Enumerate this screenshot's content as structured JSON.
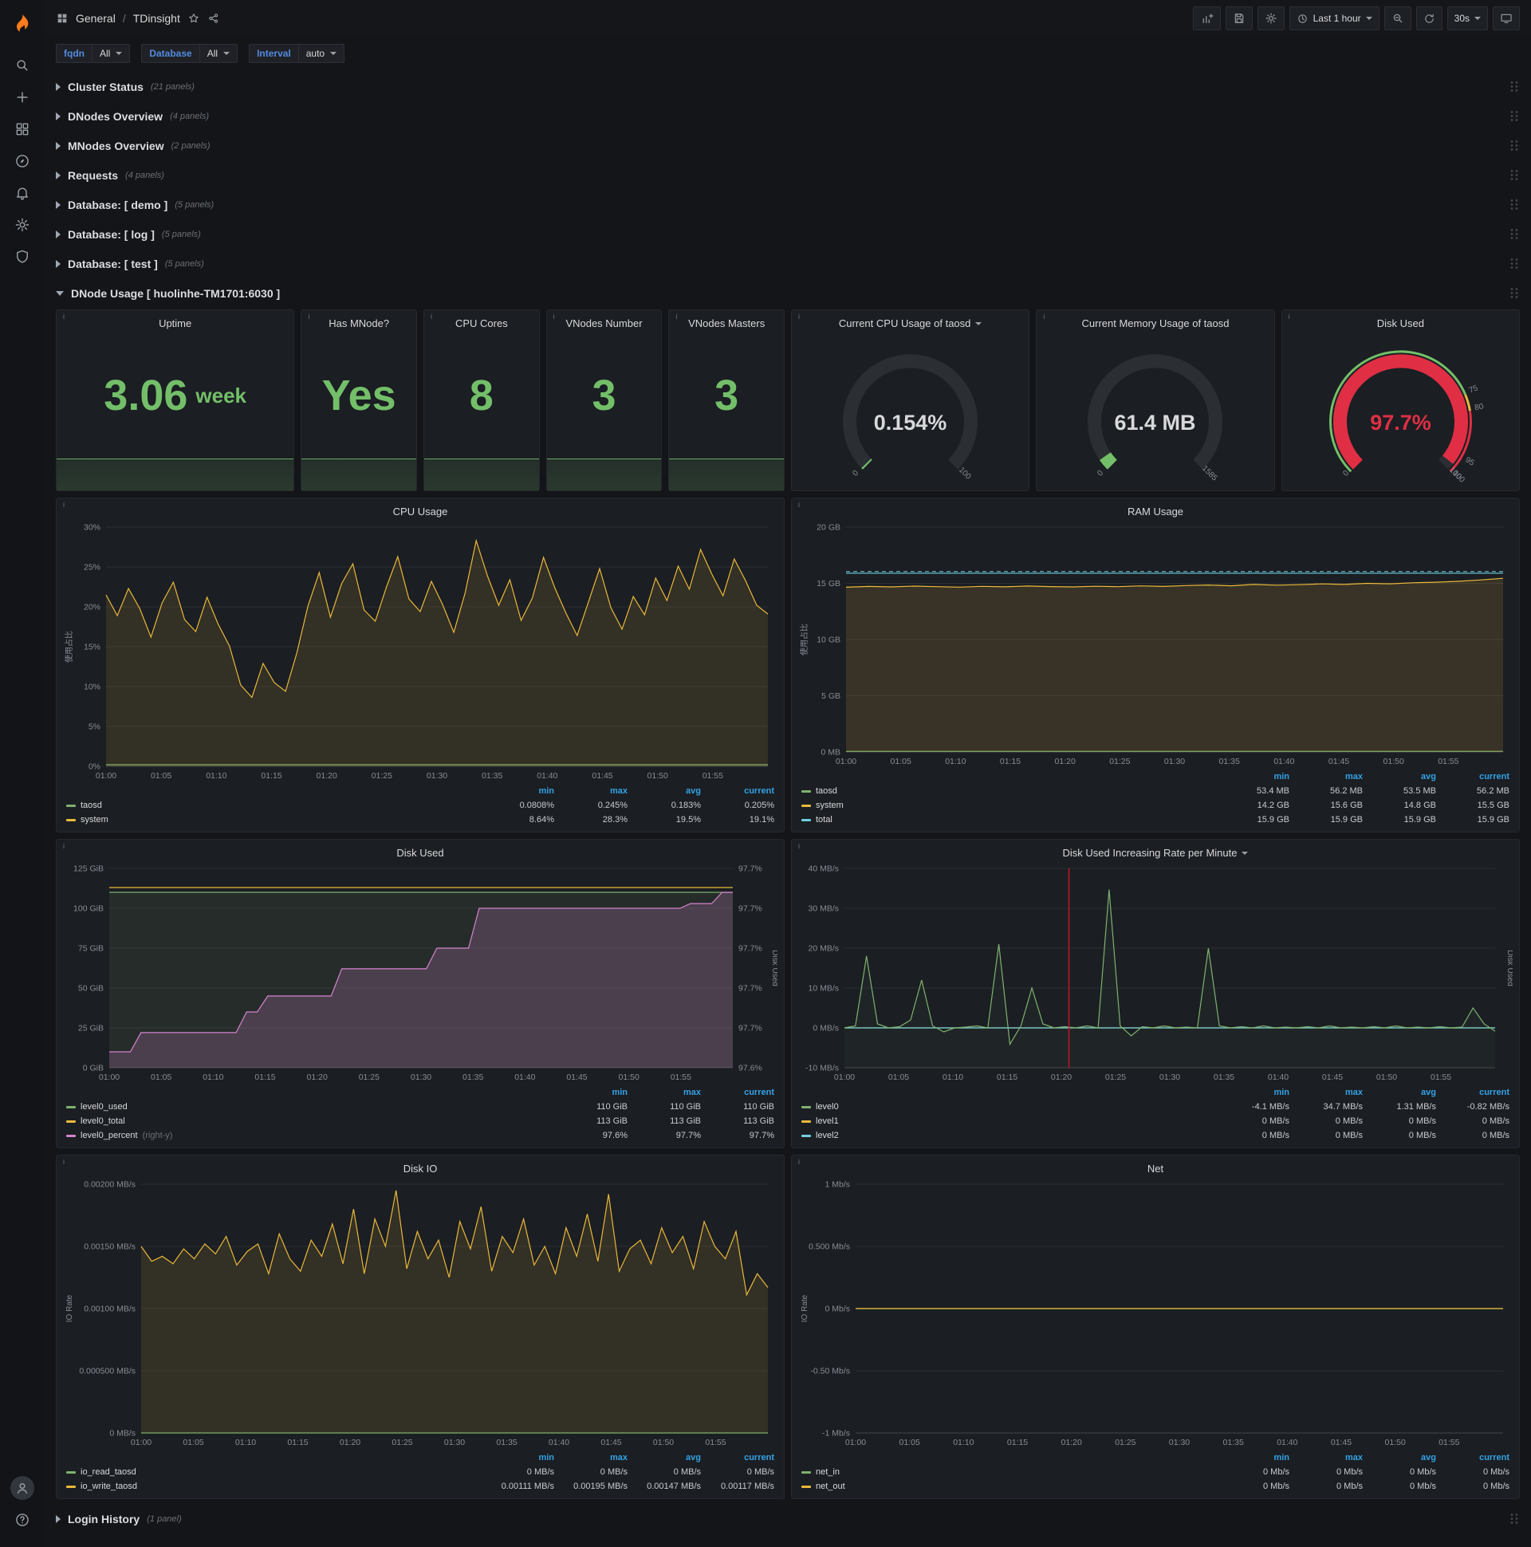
{
  "nav": {
    "breadcrumb_section": "General",
    "breadcrumb_sep": "/",
    "dashboard_title": "TDinsight",
    "time_range": "Last 1 hour",
    "refresh_interval": "30s"
  },
  "variables": [
    {
      "label": "fqdn",
      "value": "All"
    },
    {
      "label": "Database",
      "value": "All"
    },
    {
      "label": "Interval",
      "value": "auto"
    }
  ],
  "rows_top": [
    {
      "title": "Cluster Status",
      "count": "(21 panels)"
    },
    {
      "title": "DNodes Overview",
      "count": "(4 panels)"
    },
    {
      "title": "MNodes Overview",
      "count": "(2 panels)"
    },
    {
      "title": "Requests",
      "count": "(4 panels)"
    },
    {
      "title": "Database: [ demo ]",
      "count": "(5 panels)"
    },
    {
      "title": "Database: [ log ]",
      "count": "(5 panels)"
    },
    {
      "title": "Database: [ test ]",
      "count": "(5 panels)"
    }
  ],
  "dnode_row": {
    "title": "DNode Usage [ huolinhe-TM1701:6030 ]"
  },
  "rows_bottom": [
    {
      "title": "Login History",
      "count": "(1 panel)"
    }
  ],
  "stats": [
    {
      "title": "Uptime",
      "value": "3.06",
      "unit": "week"
    },
    {
      "title": "Has MNode?",
      "value": "Yes",
      "unit": ""
    },
    {
      "title": "CPU Cores",
      "value": "8",
      "unit": ""
    },
    {
      "title": "VNodes Number",
      "value": "3",
      "unit": ""
    },
    {
      "title": "VNodes Masters",
      "value": "3",
      "unit": ""
    }
  ],
  "gauges": [
    {
      "title": "Current CPU Usage of taosd",
      "value": "0.154%",
      "min_label": "0",
      "max_label": "100",
      "fraction": 0.00154,
      "color": "#73BF69",
      "value_color": "#d8d9da"
    },
    {
      "title": "Current Memory Usage of taosd",
      "value": "61.4 MB",
      "min_label": "0",
      "max_label": "1585",
      "fraction": 0.0387,
      "color": "#73BF69",
      "value_color": "#d8d9da"
    },
    {
      "title": "Disk Used",
      "value": "97.7%",
      "min_label": "0",
      "max_label": "100",
      "fraction": 0.977,
      "color": "#E02F44",
      "value_color": "#E02F44",
      "thresholds": [
        {
          "from": 0,
          "to": 0.75,
          "color": "#73BF69"
        },
        {
          "from": 0.75,
          "to": 0.8,
          "color": "#EAB839"
        },
        {
          "from": 0.8,
          "to": 1,
          "color": "#E02F44"
        }
      ],
      "threshold_labels": [
        {
          "f": 0.75,
          "t": "75"
        },
        {
          "f": 0.8,
          "t": "80"
        },
        {
          "f": 0.95,
          "t": "95"
        },
        {
          "f": 1,
          "t": "100"
        }
      ]
    }
  ],
  "charts": {
    "cpu_usage": {
      "title": "CPU Usage",
      "ylabel": "使用占比",
      "ml": 38,
      "ymin": 0,
      "ymax": 30,
      "y_ticks": [
        "30%",
        "25%",
        "20%",
        "15%",
        "10%",
        "5%",
        "0%"
      ],
      "x_ticks": [
        "01:00",
        "01:05",
        "01:10",
        "01:15",
        "01:20",
        "01:25",
        "01:30",
        "01:35",
        "01:40",
        "01:45",
        "01:50",
        "01:55"
      ],
      "series": [
        {
          "name": "taosd",
          "color": "#7EB26D",
          "fill": 0.06,
          "values": [
            0.2,
            0.2,
            0.2,
            0.2,
            0.2,
            0.2,
            0.2,
            0.2,
            0.2,
            0.2,
            0.2,
            0.2
          ]
        },
        {
          "name": "system",
          "color": "#EAB839",
          "fill": 0.12,
          "values": [
            21.5,
            18.9,
            22.3,
            19.8,
            16.2,
            20.5,
            23.1,
            18.4,
            16.9,
            21.2,
            17.8,
            15.1,
            10.2,
            8.64,
            12.9,
            10.5,
            9.4,
            14.2,
            20.1,
            24.3,
            18.7,
            22.9,
            25.4,
            19.6,
            18.2,
            22.5,
            26.3,
            21.0,
            19.4,
            23.2,
            20.3,
            16.8,
            21.7,
            28.3,
            23.9,
            20.2,
            23.4,
            18.3,
            21.1,
            26.2,
            22.4,
            19.2,
            16.4,
            20.6,
            24.8,
            19.9,
            17.2,
            21.3,
            19.0,
            23.6,
            20.8,
            25.1,
            22.2,
            27.2,
            24.1,
            21.4,
            26.0,
            23.3,
            20.2,
            19.1
          ]
        }
      ],
      "legend": {
        "columns": [
          "min",
          "max",
          "avg",
          "current"
        ],
        "rows": [
          {
            "name": "taosd",
            "color": "#7EB26D",
            "values": [
              "0.0808%",
              "0.245%",
              "0.183%",
              "0.205%"
            ]
          },
          {
            "name": "system",
            "color": "#EAB839",
            "values": [
              "8.64%",
              "28.3%",
              "19.5%",
              "19.1%"
            ]
          }
        ]
      }
    },
    "ram_usage": {
      "title": "RAM Usage",
      "ylabel": "使用占比",
      "ml": 44,
      "ymin": 0,
      "ymax": 20,
      "y_ticks": [
        "20 GB",
        "15 GB",
        "10 GB",
        "5 GB",
        "0 MB"
      ],
      "x_ticks": [
        "01:00",
        "01:05",
        "01:10",
        "01:15",
        "01:20",
        "01:25",
        "01:30",
        "01:35",
        "01:40",
        "01:45",
        "01:50",
        "01:55"
      ],
      "hline": {
        "y": 16.05,
        "color": "#6ED0E0"
      },
      "series": [
        {
          "name": "taosd",
          "color": "#7EB26D",
          "fill": 0.06,
          "values": [
            0.055,
            0.055,
            0.055,
            0.055,
            0.055,
            0.055,
            0.055,
            0.055,
            0.055,
            0.055,
            0.055,
            0.055
          ]
        },
        {
          "name": "system",
          "color": "#EAB839",
          "fill": 0.14,
          "values": [
            14.65,
            14.72,
            14.68,
            14.75,
            14.7,
            14.66,
            14.73,
            14.69,
            14.76,
            14.71,
            14.68,
            14.74,
            14.7,
            14.77,
            14.72,
            14.8,
            14.85,
            14.78,
            14.9,
            14.84,
            14.88,
            14.95,
            14.9,
            15.0,
            14.96,
            15.05,
            15.1,
            15.18,
            15.3,
            15.45
          ]
        },
        {
          "name": "total",
          "color": "#6ED0E0",
          "fill": 0,
          "values": [
            15.9,
            15.9,
            15.9,
            15.9,
            15.9,
            15.9,
            15.9,
            15.9,
            15.9,
            15.9,
            15.9,
            15.9
          ]
        }
      ],
      "legend": {
        "columns": [
          "min",
          "max",
          "avg",
          "current"
        ],
        "rows": [
          {
            "name": "taosd",
            "color": "#7EB26D",
            "values": [
              "53.4 MB",
              "56.2 MB",
              "53.5 MB",
              "56.2 MB"
            ]
          },
          {
            "name": "system",
            "color": "#EAB839",
            "values": [
              "14.2 GB",
              "15.6 GB",
              "14.8 GB",
              "15.5 GB"
            ]
          },
          {
            "name": "total",
            "color": "#6ED0E0",
            "values": [
              "15.9 GB",
              "15.9 GB",
              "15.9 GB",
              "15.9 GB"
            ]
          }
        ]
      }
    },
    "disk_used": {
      "title": "Disk Used",
      "ml": 52,
      "ymin": 0,
      "ymax": 125,
      "y_ticks": [
        "125 GiB",
        "100 GiB",
        "75 GiB",
        "50 GiB",
        "25 GiB",
        "0 GiB"
      ],
      "y2_ticks": [
        "97.7%",
        "97.7%",
        "97.7%",
        "97.7%",
        "97.7%",
        "97.6%"
      ],
      "y2min": 97.6,
      "y2max": 97.71,
      "y2label": "Disk Used",
      "x_ticks": [
        "01:00",
        "01:05",
        "01:10",
        "01:15",
        "01:20",
        "01:25",
        "01:30",
        "01:35",
        "01:40",
        "01:45",
        "01:50",
        "01:55"
      ],
      "series": [
        {
          "name": "level0_used",
          "color": "#7EB26D",
          "fill": 0.1,
          "values": [
            110,
            110,
            110,
            110,
            110,
            110,
            110,
            110,
            110,
            110,
            110,
            110
          ]
        },
        {
          "name": "level0_total",
          "color": "#EAB839",
          "fill": 0,
          "values": [
            113,
            113,
            113,
            113,
            113,
            113,
            113,
            113,
            113,
            113,
            113,
            113
          ]
        },
        {
          "name": "level0_percent",
          "color": "#D683CE",
          "fill": 0.22,
          "axis": 2,
          "values": [
            97.6088,
            97.6088,
            97.6088,
            97.6194,
            97.6194,
            97.6194,
            97.6194,
            97.6194,
            97.6194,
            97.6194,
            97.6194,
            97.6194,
            97.6194,
            97.6308,
            97.6308,
            97.6396,
            97.6396,
            97.6396,
            97.6396,
            97.6396,
            97.6396,
            97.6396,
            97.6546,
            97.6546,
            97.6546,
            97.6546,
            97.6546,
            97.6546,
            97.6546,
            97.6546,
            97.6546,
            97.666,
            97.666,
            97.666,
            97.666,
            97.688,
            97.688,
            97.688,
            97.688,
            97.688,
            97.688,
            97.688,
            97.688,
            97.688,
            97.688,
            97.688,
            97.688,
            97.688,
            97.688,
            97.688,
            97.688,
            97.688,
            97.688,
            97.688,
            97.688,
            97.6906,
            97.6906,
            97.6906,
            97.6968,
            97.6968
          ]
        }
      ],
      "legend": {
        "columns": [
          "min",
          "max",
          "current"
        ],
        "rows": [
          {
            "name": "level0_used",
            "color": "#7EB26D",
            "values": [
              "110 GiB",
              "110 GiB",
              "110 GiB"
            ]
          },
          {
            "name": "level0_total",
            "color": "#EAB839",
            "values": [
              "113 GiB",
              "113 GiB",
              "113 GiB"
            ]
          },
          {
            "name": "level0_percent",
            "suffix": "(right-y)",
            "color": "#D683CE",
            "values": [
              "97.6%",
              "97.7%",
              "97.7%"
            ]
          }
        ]
      }
    },
    "disk_rate": {
      "title": "Disk Used Increasing Rate per Minute",
      "has_caret": true,
      "ml": 52,
      "ymin": -10,
      "ymax": 40,
      "y_ticks": [
        "40 MB/s",
        "30 MB/s",
        "20 MB/s",
        "10 MB/s",
        "0 MB/s",
        "-10 MB/s"
      ],
      "y2label": "Disk Used",
      "vline": 0.345,
      "x_ticks": [
        "01:00",
        "01:05",
        "01:10",
        "01:15",
        "01:20",
        "01:25",
        "01:30",
        "01:35",
        "01:40",
        "01:45",
        "01:50",
        "01:55"
      ],
      "series": [
        {
          "name": "level1",
          "color": "#EAB839",
          "fill": 0,
          "values": [
            0,
            0,
            0,
            0,
            0,
            0,
            0,
            0,
            0,
            0,
            0,
            0
          ]
        },
        {
          "name": "level2",
          "color": "#6ED0E0",
          "fill": 0,
          "values": [
            0,
            0,
            0,
            0,
            0,
            0,
            0,
            0,
            0,
            0,
            0,
            0
          ]
        },
        {
          "name": "level0",
          "color": "#7EB26D",
          "fill": 0.05,
          "values": [
            0,
            0.5,
            18,
            1,
            0,
            0.3,
            2,
            12,
            0.5,
            -1,
            0,
            0.2,
            0.5,
            0,
            21,
            -4.1,
            0.5,
            10,
            1,
            0,
            0.3,
            0,
            0.5,
            0,
            34.7,
            0.5,
            -2,
            0.3,
            0,
            0.5,
            0,
            0.2,
            0,
            20,
            0.5,
            0,
            0.3,
            0,
            0.5,
            0,
            0.2,
            0,
            0.3,
            0,
            0.5,
            0,
            0.2,
            0,
            0.3,
            0,
            0.5,
            0,
            0.2,
            0,
            0.3,
            0,
            0.2,
            5,
            1,
            -0.82
          ]
        }
      ],
      "legend": {
        "columns": [
          "min",
          "max",
          "avg",
          "current"
        ],
        "rows": [
          {
            "name": "level0",
            "color": "#7EB26D",
            "values": [
              "-4.1 MB/s",
              "34.7 MB/s",
              "1.31 MB/s",
              "-0.82 MB/s"
            ]
          },
          {
            "name": "level1",
            "color": "#EAB839",
            "values": [
              "0 MB/s",
              "0 MB/s",
              "0 MB/s",
              "0 MB/s"
            ]
          },
          {
            "name": "level2",
            "color": "#6ED0E0",
            "values": [
              "0 MB/s",
              "0 MB/s",
              "0 MB/s",
              "0 MB/s"
            ]
          }
        ]
      }
    },
    "disk_io": {
      "title": "Disk IO",
      "ylabel": "IO Rate",
      "ml": 82,
      "ymin": 0,
      "ymax": 0.002,
      "y_ticks": [
        "0.00200 MB/s",
        "0.00150 MB/s",
        "0.00100 MB/s",
        "0.000500 MB/s",
        "0 MB/s"
      ],
      "x_ticks": [
        "01:00",
        "01:05",
        "01:10",
        "01:15",
        "01:20",
        "01:25",
        "01:30",
        "01:35",
        "01:40",
        "01:45",
        "01:50",
        "01:55"
      ],
      "series": [
        {
          "name": "io_read_taosd",
          "color": "#7EB26D",
          "fill": 0,
          "values": [
            0,
            0,
            0,
            0,
            0,
            0,
            0,
            0,
            0,
            0,
            0,
            0
          ]
        },
        {
          "name": "io_write_taosd",
          "color": "#EAB839",
          "fill": 0.12,
          "values": [
            0.0015,
            0.00138,
            0.00142,
            0.00136,
            0.00148,
            0.0014,
            0.00152,
            0.00144,
            0.00158,
            0.00135,
            0.00146,
            0.00152,
            0.00128,
            0.0016,
            0.0014,
            0.0013,
            0.00155,
            0.00142,
            0.00168,
            0.00136,
            0.0018,
            0.00128,
            0.00172,
            0.0015,
            0.00195,
            0.00132,
            0.00162,
            0.0014,
            0.00155,
            0.00125,
            0.0017,
            0.00148,
            0.00182,
            0.0013,
            0.00158,
            0.00145,
            0.00172,
            0.00135,
            0.0015,
            0.00128,
            0.00165,
            0.00142,
            0.00176,
            0.00138,
            0.00192,
            0.0013,
            0.00148,
            0.00155,
            0.00136,
            0.00165,
            0.00145,
            0.00158,
            0.00132,
            0.0017,
            0.0015,
            0.0014,
            0.00162,
            0.00111,
            0.00128,
            0.00117
          ]
        }
      ],
      "legend": {
        "columns": [
          "min",
          "max",
          "avg",
          "current"
        ],
        "rows": [
          {
            "name": "io_read_taosd",
            "color": "#7EB26D",
            "values": [
              "0 MB/s",
              "0 MB/s",
              "0 MB/s",
              "0 MB/s"
            ]
          },
          {
            "name": "io_write_taosd",
            "color": "#EAB839",
            "values": [
              "0.00111 MB/s",
              "0.00195 MB/s",
              "0.00147 MB/s",
              "0.00117 MB/s"
            ]
          }
        ]
      }
    },
    "net": {
      "title": "Net",
      "ylabel": "IO Rate",
      "ml": 56,
      "ymin": -1,
      "ymax": 1,
      "y_ticks": [
        "1 Mb/s",
        "0.500 Mb/s",
        "0 Mb/s",
        "-0.50 Mb/s",
        "-1 Mb/s"
      ],
      "x_ticks": [
        "01:00",
        "01:05",
        "01:10",
        "01:15",
        "01:20",
        "01:25",
        "01:30",
        "01:35",
        "01:40",
        "01:45",
        "01:50",
        "01:55"
      ],
      "series": [
        {
          "name": "net_in",
          "color": "#7EB26D",
          "fill": 0,
          "values": [
            0,
            0,
            0,
            0,
            0,
            0,
            0,
            0,
            0,
            0,
            0,
            0
          ]
        },
        {
          "name": "net_out",
          "color": "#EAB839",
          "fill": 0,
          "values": [
            0,
            0,
            0,
            0,
            0,
            0,
            0,
            0,
            0,
            0,
            0,
            0
          ]
        }
      ],
      "legend": {
        "columns": [
          "min",
          "max",
          "avg",
          "current"
        ],
        "rows": [
          {
            "name": "net_in",
            "color": "#7EB26D",
            "values": [
              "0 Mb/s",
              "0 Mb/s",
              "0 Mb/s",
              "0 Mb/s"
            ]
          },
          {
            "name": "net_out",
            "color": "#EAB839",
            "values": [
              "0 Mb/s",
              "0 Mb/s",
              "0 Mb/s",
              "0 Mb/s"
            ]
          }
        ]
      }
    }
  }
}
